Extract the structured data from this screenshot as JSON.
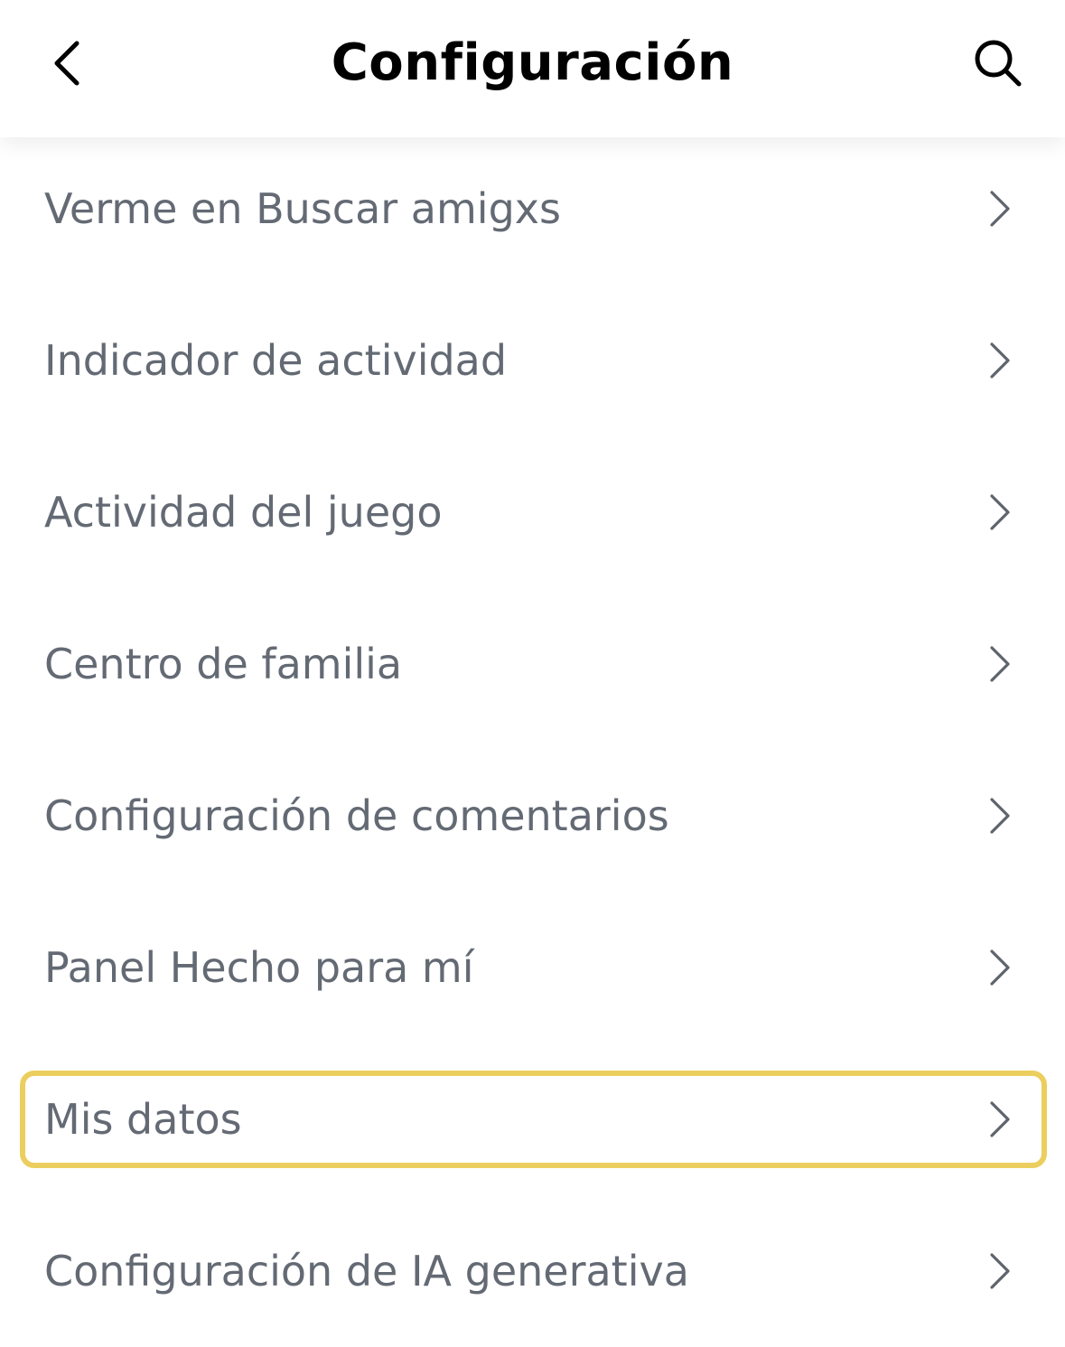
{
  "header": {
    "title": "Configuración",
    "back_icon": "chevron-left-icon",
    "search_icon": "search-icon"
  },
  "settings": {
    "items": [
      {
        "label": "Verme en Buscar amigxs",
        "highlighted": false
      },
      {
        "label": "Indicador de actividad",
        "highlighted": false
      },
      {
        "label": "Actividad del juego",
        "highlighted": false
      },
      {
        "label": "Centro de familia",
        "highlighted": false
      },
      {
        "label": "Configuración de comentarios",
        "highlighted": false
      },
      {
        "label": "Panel Hecho para mí",
        "highlighted": false
      },
      {
        "label": "Mis datos",
        "highlighted": true
      },
      {
        "label": "Configuración de IA generativa",
        "highlighted": false
      }
    ]
  },
  "colors": {
    "label_text": "#646a74",
    "highlight_border": "#ecce5f",
    "title_text": "#000000"
  }
}
